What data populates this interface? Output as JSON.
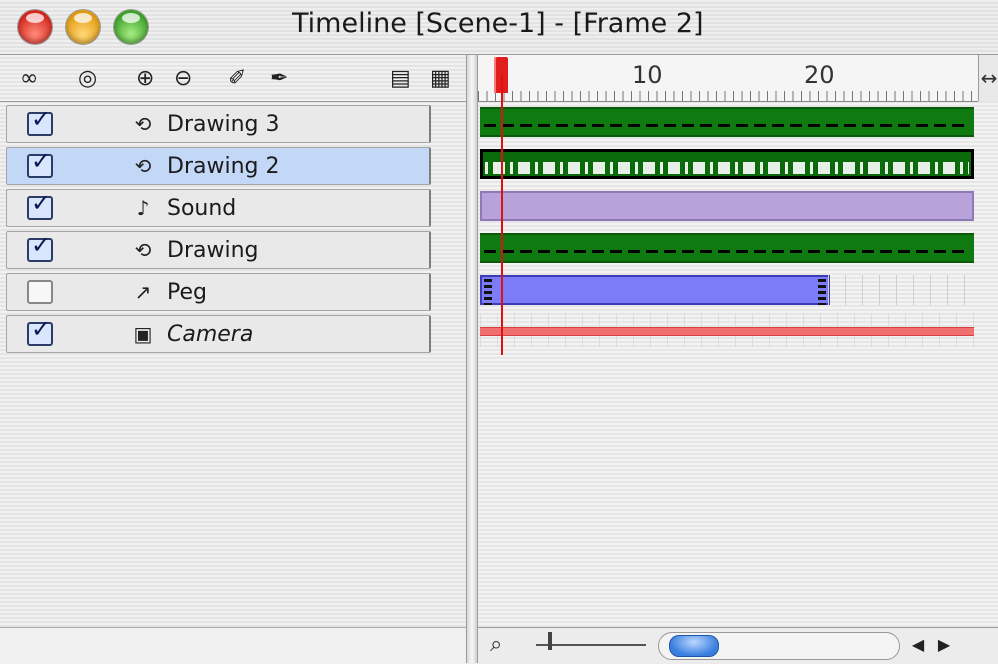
{
  "window": {
    "title": "Timeline [Scene-1] - [Frame 2]"
  },
  "toolbar": {
    "icons": [
      "onion-skin-icon",
      "circle-icon",
      "add-layer-icon",
      "remove-layer-icon",
      "drawing-icon",
      "peg-icon",
      "folder-icon",
      "properties-icon"
    ]
  },
  "layers": [
    {
      "name": "Drawing 3",
      "visible": true,
      "icon": "drawing-icon",
      "selected": false
    },
    {
      "name": "Drawing 2",
      "visible": true,
      "icon": "drawing-icon",
      "selected": true
    },
    {
      "name": "Sound",
      "visible": true,
      "icon": "sound-icon",
      "selected": false
    },
    {
      "name": "Drawing",
      "visible": true,
      "icon": "drawing-icon",
      "selected": false
    },
    {
      "name": "Peg",
      "visible": false,
      "icon": "peg-icon",
      "selected": false
    },
    {
      "name": "Camera",
      "visible": true,
      "icon": "camera-icon",
      "selected": false
    }
  ],
  "ruler": {
    "labels": [
      "10",
      "20"
    ],
    "current_frame": 2
  },
  "colors": {
    "drawing_track": "#0f7a10",
    "sound_track": "#b7a2da",
    "peg_track": "#7c7cf7",
    "camera_track": "#f07070",
    "playhead": "#e21d1d",
    "selected_row": "#c3d8f6"
  }
}
